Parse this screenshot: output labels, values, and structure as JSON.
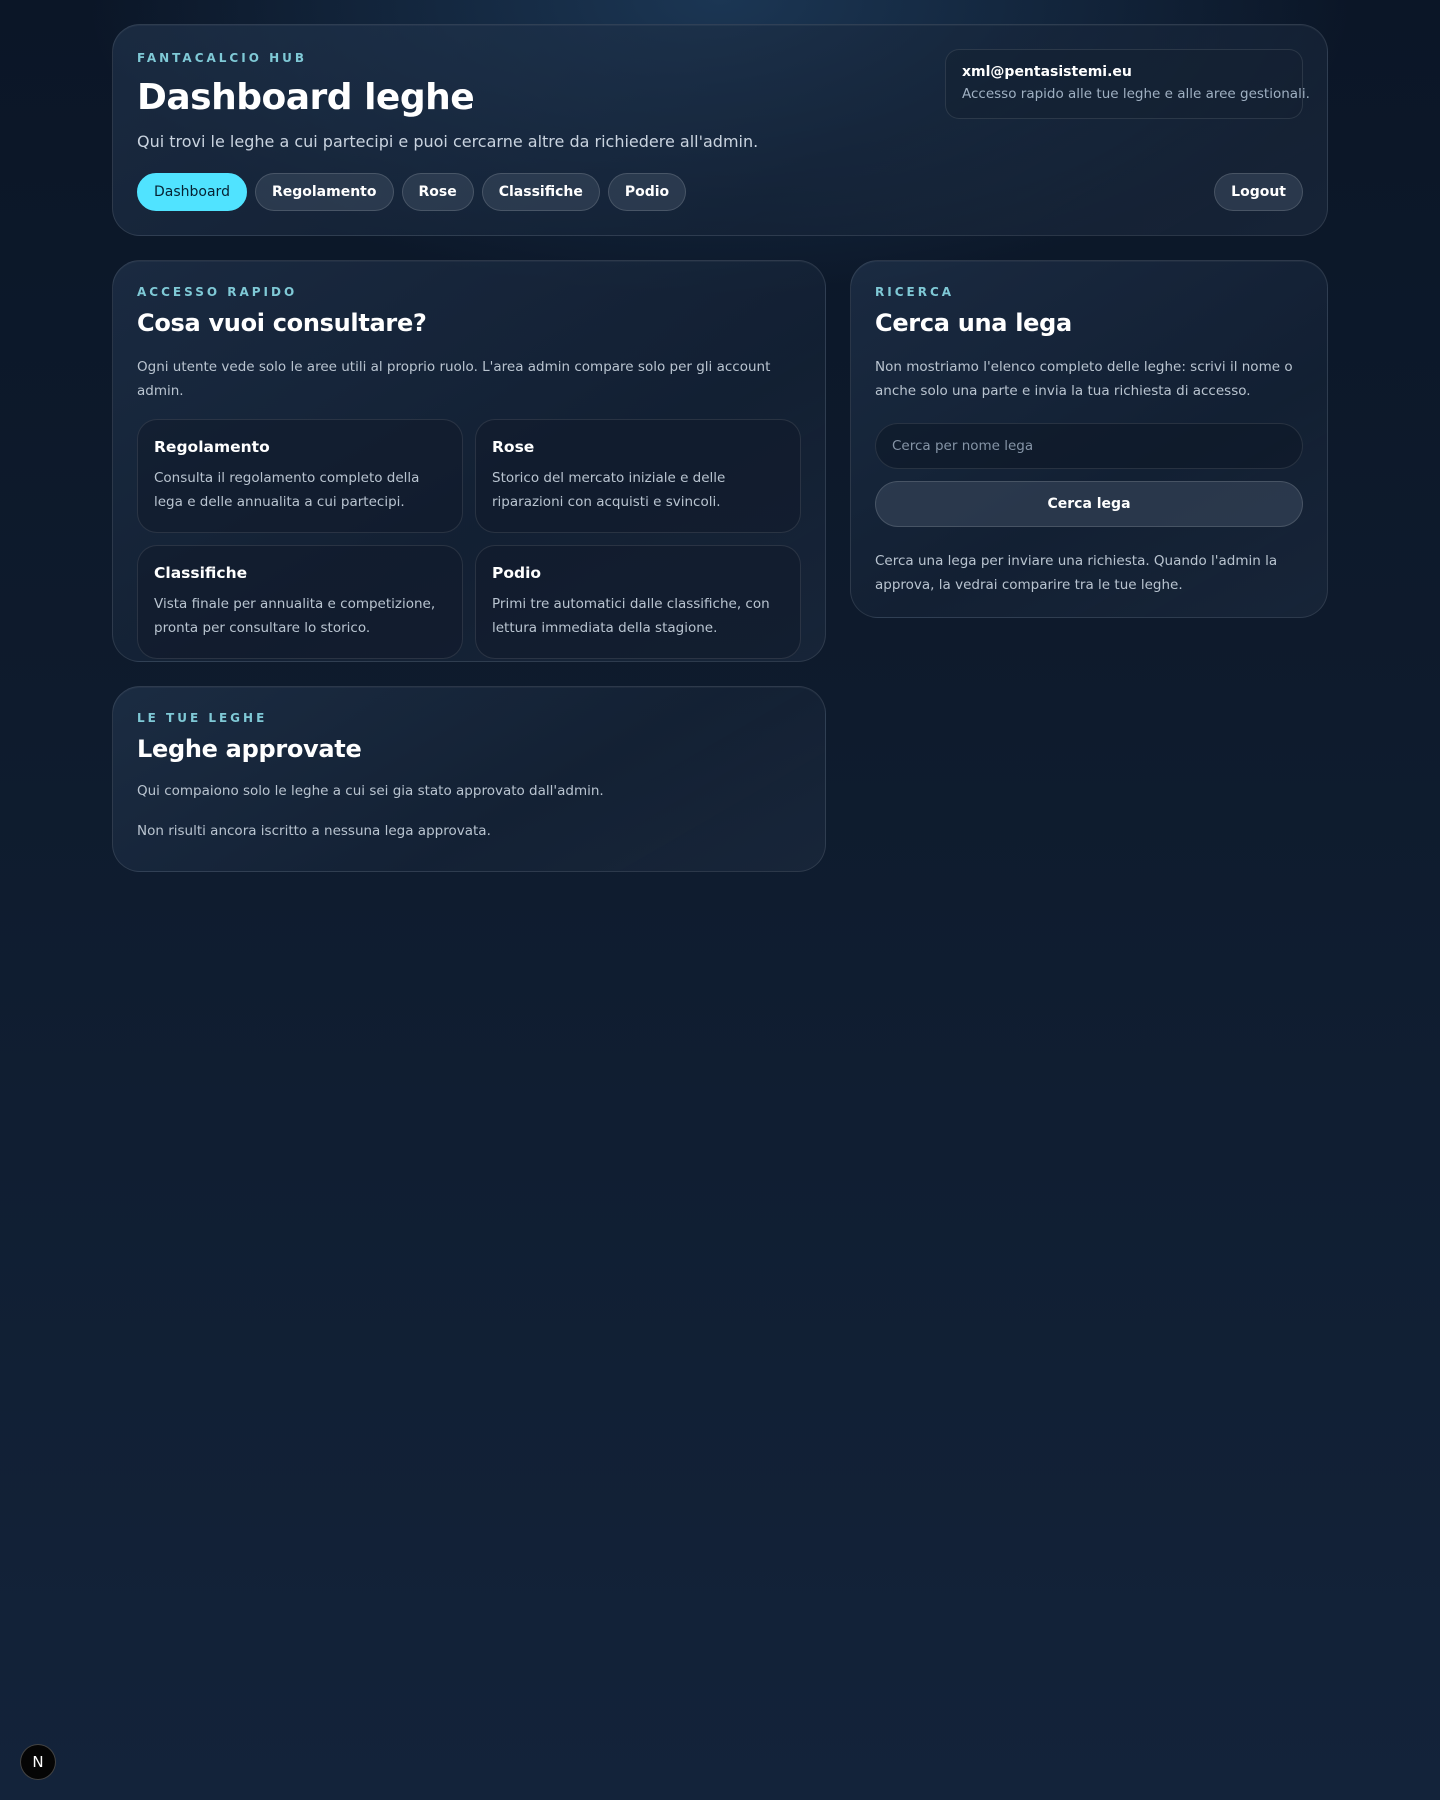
{
  "header": {
    "eyebrow": "FANTACALCIO HUB",
    "title": "Dashboard leghe",
    "subtitle": "Qui trovi le leghe a cui partecipi e puoi cercarne altre da richiedere all'admin.",
    "user_email": "xml@pentasistemi.eu",
    "user_description": "Accesso rapido alle tue leghe e alle aree gestionali.",
    "nav": [
      {
        "label": "Dashboard",
        "active": true
      },
      {
        "label": "Regolamento",
        "active": false
      },
      {
        "label": "Rose",
        "active": false
      },
      {
        "label": "Classifiche",
        "active": false
      },
      {
        "label": "Podio",
        "active": false
      }
    ],
    "logout_label": "Logout"
  },
  "quick_access": {
    "eyebrow": "ACCESSO RAPIDO",
    "title": "Cosa vuoi consultare?",
    "description": "Ogni utente vede solo le aree utili al proprio ruolo. L'area admin compare solo per gli account admin.",
    "tiles": [
      {
        "title": "Regolamento",
        "description": "Consulta il regolamento completo della lega e delle annualita a cui partecipi."
      },
      {
        "title": "Rose",
        "description": "Storico del mercato iniziale e delle riparazioni con acquisti e svincoli."
      },
      {
        "title": "Classifiche",
        "description": "Vista finale per annualita e competizione, pronta per consultare lo storico."
      },
      {
        "title": "Podio",
        "description": "Primi tre automatici dalle classifiche, con lettura immediata della stagione."
      }
    ]
  },
  "my_leagues": {
    "eyebrow": "LE TUE LEGHE",
    "title": "Leghe approvate",
    "description": "Qui compaiono solo le leghe a cui sei gia stato approvato dall'admin.",
    "empty_message": "Non risulti ancora iscritto a nessuna lega approvata."
  },
  "search": {
    "eyebrow": "RICERCA",
    "title": "Cerca una lega",
    "description": "Non mostriamo l'elenco completo delle leghe: scrivi il nome o anche solo una parte e invia la tua richiesta di accesso.",
    "input_value": "",
    "input_placeholder": "Cerca per nome lega",
    "button_label": "Cerca lega",
    "note": "Cerca una lega per inviare una richiesta. Quando l'admin la approva, la vedrai comparire tra le tue leghe."
  },
  "badge": {
    "letter": "N",
    "icon": "nextjs-icon"
  },
  "colors": {
    "accent": "#50e3ff",
    "eyebrow": "#7fc9d6",
    "background": "#0e1b2d"
  }
}
